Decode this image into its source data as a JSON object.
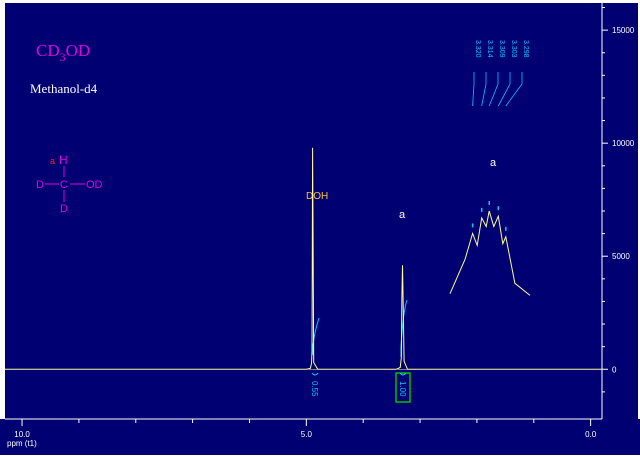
{
  "title": {
    "main": "CD",
    "sub": "3",
    "rest": "OD"
  },
  "subtitle": "Methanol-d4",
  "molecule": {
    "label_a": "a",
    "atoms": {
      "top": "H",
      "left": "D",
      "center": "C",
      "right": "OD",
      "bottom": "D"
    }
  },
  "annotations": {
    "doh_label": "DOH",
    "peak_label": "a",
    "inset_label": "a"
  },
  "peak_list": [
    "3.320",
    "3.314",
    "3.309",
    "3.303",
    "3.298"
  ],
  "integrals": [
    {
      "value": "0.55",
      "boxed": false
    },
    {
      "value": "1.00",
      "boxed": true
    }
  ],
  "axes": {
    "x_label": "ppm (t1)",
    "x_ticks": [
      "10.0",
      "5.0",
      "0.0"
    ],
    "x_tick_values": [
      10.0,
      5.0,
      0.0
    ],
    "x_range": [
      10.3,
      -0.2
    ],
    "y_ticks": [
      "15000",
      "10000",
      "5000",
      "0"
    ],
    "y_tick_values": [
      15000,
      10000,
      5000,
      0
    ],
    "y_range": [
      -2200,
      16200
    ]
  },
  "chart_data": {
    "type": "line",
    "title": "CD3OD",
    "subtitle": "Methanol-d4",
    "xlabel": "ppm (t1)",
    "ylabel": "",
    "xlim": [
      10.3,
      -0.2
    ],
    "ylim": [
      -2200,
      16200
    ],
    "series": [
      {
        "x": [
          10.3,
          5.0,
          4.93,
          4.91,
          4.9,
          4.89,
          4.87,
          4.8,
          3.42,
          3.35,
          3.33,
          3.32,
          3.314,
          3.309,
          3.303,
          3.298,
          3.28,
          3.22,
          -0.2
        ],
        "y": [
          0,
          0,
          40,
          250,
          800,
          9800,
          300,
          0,
          0,
          80,
          500,
          3200,
          3900,
          4600,
          3900,
          3100,
          350,
          0,
          0
        ]
      }
    ],
    "inset": {
      "label": "a",
      "x": [
        3.335,
        3.325,
        3.32,
        3.317,
        3.314,
        3.311,
        3.309,
        3.306,
        3.303,
        3.3,
        3.298,
        3.292,
        3.282
      ],
      "y": [
        2400,
        4400,
        5900,
        5200,
        6800,
        6300,
        7200,
        6300,
        6900,
        5300,
        5700,
        3000,
        2300
      ]
    }
  },
  "colors": {
    "background": "#000072",
    "panel": "#ffffff",
    "spectrum": "#ffff99",
    "integral": "#00c8ff",
    "title": "#e000e0",
    "subtitle": "#ffffff",
    "doh": "#ffc040",
    "label_red": "#ff2020",
    "box": "#00c000",
    "axis_text": "#ffffff"
  }
}
